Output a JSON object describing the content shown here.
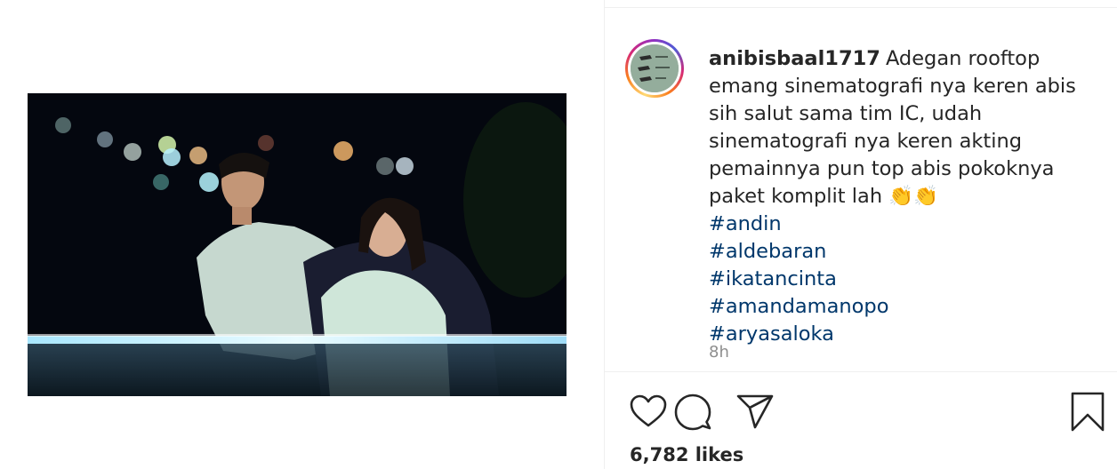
{
  "post": {
    "username": "anibisbaal1717",
    "caption_text": "Adegan rooftop emang sinematografi nya keren abis sih salut sama tim IC, udah sinematografi nya keren akting pemainnya pun top abis pokoknya paket komplit lah",
    "caption_emoji": "👏👏",
    "hashtags": [
      "#andin",
      "#aldebaran",
      "#ikatancinta",
      "#amandamanopo",
      "#aryasaloka"
    ],
    "timestamp": "8h",
    "likes": "6,782 likes"
  },
  "actions": {
    "like_icon": "heart-icon",
    "comment_icon": "comment-icon",
    "share_icon": "send-icon",
    "save_icon": "bookmark-icon"
  },
  "colors": {
    "hashtag": "#00376b",
    "text": "#262626",
    "muted": "#8e8e8e"
  }
}
